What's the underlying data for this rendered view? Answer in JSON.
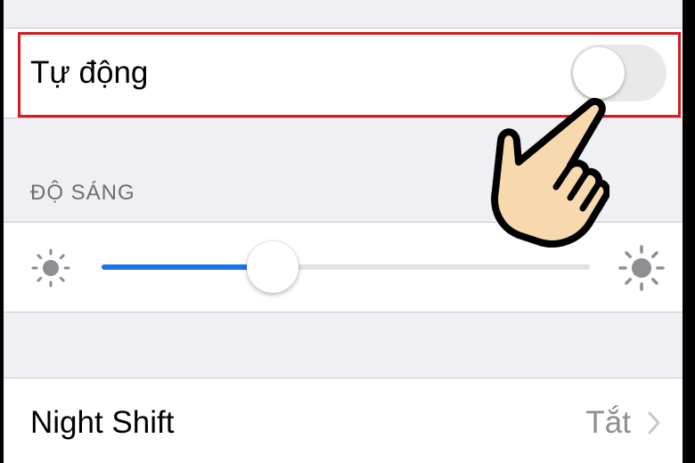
{
  "auto_brightness": {
    "label": "Tự động",
    "enabled": false
  },
  "brightness": {
    "section_header": "ĐỘ SÁNG",
    "level": 0.35
  },
  "night_shift": {
    "label": "Night Shift",
    "value": "Tắt"
  },
  "colors": {
    "highlight": "#d71920",
    "slider_fill": "#1a73e8",
    "toggle_off": "#e9e9ea",
    "background": "#efeff4",
    "secondary_text": "#8e8e93"
  },
  "icons": {
    "brightness_low": "sun-small-icon",
    "brightness_high": "sun-large-icon",
    "chevron": "chevron-right-icon",
    "pointer": "pointing-hand-icon"
  }
}
